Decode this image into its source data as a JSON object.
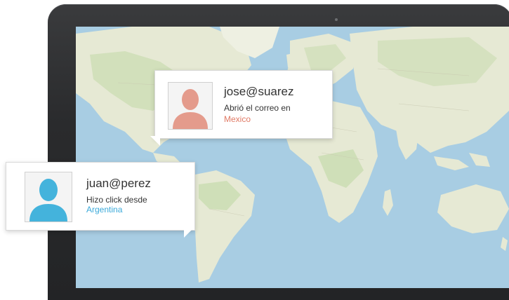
{
  "popups": [
    {
      "username": "jose@suarez",
      "action": "Abrió el correo en",
      "location": "Mexico",
      "avatar_color": "#e49b8c",
      "location_color": "#e07a65"
    },
    {
      "username": "juan@perez",
      "action": "Hizo click desde",
      "location": "Argentina",
      "avatar_color": "#44b3dc",
      "location_color": "#3ba9d9"
    }
  ],
  "map": {
    "water_color": "#a8cde3",
    "land_color": "#e6e9d4",
    "forest_color": "#c9dcb0"
  },
  "icons": [
    "person-silhouette-icon"
  ]
}
